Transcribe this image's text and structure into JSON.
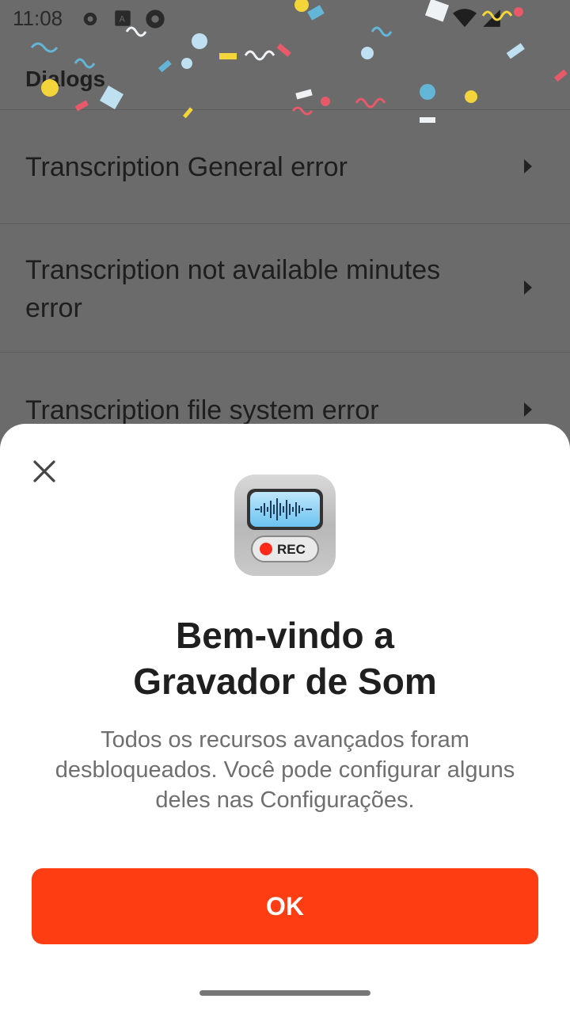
{
  "status_bar": {
    "time": "11:08",
    "icons": [
      "gear-icon",
      "keyboard-a-icon",
      "camera-shutter-icon",
      "wifi-icon",
      "signal-icon"
    ]
  },
  "app_bar": {
    "title": "Dialogs"
  },
  "list": {
    "items": [
      {
        "label": "Transcription General error"
      },
      {
        "label": "Transcription not available minutes error"
      },
      {
        "label": "Transcription file system error"
      }
    ]
  },
  "dialog": {
    "app_icon": "sound-recorder-rec-icon",
    "icon_text": "REC",
    "title_line1": "Bem-vindo a",
    "title_line2": "Gravador de Som",
    "description": "Todos os recursos avançados foram desbloqueados. Você pode configurar alguns deles nas Configurações.",
    "ok_label": "OK"
  },
  "colors": {
    "accent": "#ff3d12",
    "scrim": "#6b6b6b",
    "sheet": "#ffffff"
  }
}
